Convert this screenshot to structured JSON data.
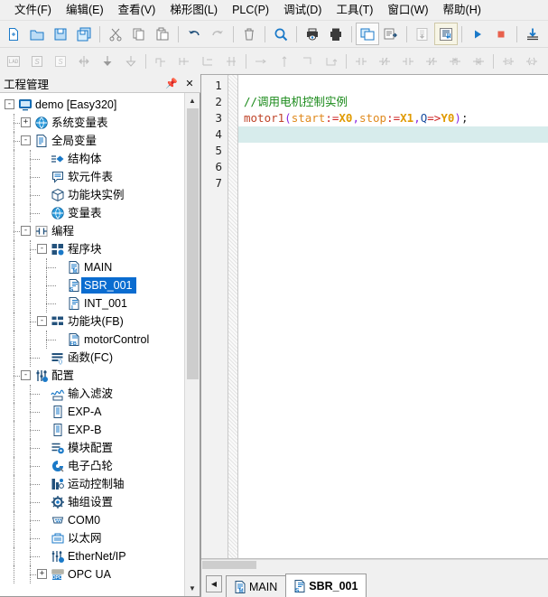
{
  "menubar": {
    "items": [
      {
        "label": "文件(F)",
        "name": "menu-file"
      },
      {
        "label": "编辑(E)",
        "name": "menu-edit"
      },
      {
        "label": "查看(V)",
        "name": "menu-view"
      },
      {
        "label": "梯形图(L)",
        "name": "menu-ladder"
      },
      {
        "label": "PLC(P)",
        "name": "menu-plc"
      },
      {
        "label": "调试(D)",
        "name": "menu-debug"
      },
      {
        "label": "工具(T)",
        "name": "menu-tools"
      },
      {
        "label": "窗口(W)",
        "name": "menu-window"
      },
      {
        "label": "帮助(H)",
        "name": "menu-help"
      }
    ]
  },
  "toolbar_row1": {
    "icons": [
      "new-file-icon",
      "open-folder-icon",
      "save-icon",
      "save-all-icon",
      "sep",
      "cut-icon",
      "copy-icon",
      "paste-icon",
      "sep",
      "undo-icon",
      "redo-icon",
      "sep",
      "delete-icon",
      "sep",
      "search-icon",
      "sep",
      "print-preview-icon",
      "print-icon",
      "sep",
      "compile-icon",
      "compile-all-icon",
      "sep",
      "upload-plc-icon",
      "download-plc-icon",
      "sep",
      "run-icon",
      "stop-icon",
      "sep",
      "download-icon"
    ]
  },
  "toolbar_row2": {
    "icons": [
      "lad-mode-icon",
      "stl-mode-icon",
      "sfc-mode-icon",
      "insert-row-icon",
      "insert-below-icon",
      "append-row-icon",
      "sep",
      "branch-up-icon",
      "branch-down-icon",
      "branch-left-icon",
      "branch-right-icon",
      "sep",
      "hline-icon",
      "vline-icon",
      "corner-icon",
      "corner2-icon",
      "sep",
      "contact-no-icon",
      "contact-nc-icon",
      "contact-no2-icon",
      "contact-nc2-icon",
      "contact-rising-icon",
      "contact-falling-icon",
      "sep",
      "set-coil-icon",
      "reset-coil-icon"
    ]
  },
  "left_panel": {
    "title": "工程管理",
    "pin_icon": "pin-icon",
    "close_icon": "close-icon",
    "scroll_up_icon": "chevron-up-icon",
    "scroll_down_icon": "chevron-down-icon",
    "tree": [
      {
        "label": "demo [Easy320]",
        "icon": "monitor-icon",
        "indent": 0,
        "expander": "-",
        "name": "tree-item-demo"
      },
      {
        "label": "系统变量表",
        "icon": "globe-icon",
        "indent": 1,
        "expander": "+",
        "name": "tree-item-system-var-table"
      },
      {
        "label": "全局变量",
        "icon": "document-list-icon",
        "indent": 1,
        "expander": "-",
        "name": "tree-item-global-variables"
      },
      {
        "label": "结构体",
        "icon": "struct-icon",
        "indent": 2,
        "expander": "",
        "name": "tree-item-struct"
      },
      {
        "label": "软元件表",
        "icon": "device-table-icon",
        "indent": 2,
        "expander": "",
        "name": "tree-item-device-table"
      },
      {
        "label": "功能块实例",
        "icon": "cube-icon",
        "indent": 2,
        "expander": "",
        "name": "tree-item-fb-instance"
      },
      {
        "label": "变量表",
        "icon": "globe-icon",
        "indent": 2,
        "expander": "",
        "name": "tree-item-variable-table"
      },
      {
        "label": "编程",
        "icon": "contact-icon",
        "indent": 1,
        "expander": "-",
        "name": "tree-item-programming"
      },
      {
        "label": "程序块",
        "icon": "blocks-icon",
        "indent": 2,
        "expander": "-",
        "name": "tree-item-program-blocks"
      },
      {
        "label": "MAIN",
        "icon": "main-pou-icon",
        "indent": 3,
        "expander": "",
        "name": "tree-item-main"
      },
      {
        "label": "SBR_001",
        "icon": "sbr-pou-icon",
        "indent": 3,
        "expander": "",
        "selected": true,
        "name": "tree-item-sbr-001"
      },
      {
        "label": "INT_001",
        "icon": "int-pou-icon",
        "indent": 3,
        "expander": "",
        "name": "tree-item-int-001"
      },
      {
        "label": "功能块(FB)",
        "icon": "fb-group-icon",
        "indent": 2,
        "expander": "-",
        "name": "tree-item-function-blocks"
      },
      {
        "label": "motorControl",
        "icon": "fb-icon",
        "indent": 3,
        "expander": "",
        "name": "tree-item-motorcontrol"
      },
      {
        "label": "函数(FC)",
        "icon": "fc-icon",
        "indent": 2,
        "expander": "",
        "name": "tree-item-functions"
      },
      {
        "label": "配置",
        "icon": "config-icon",
        "indent": 1,
        "expander": "-",
        "name": "tree-item-configuration"
      },
      {
        "label": "输入滤波",
        "icon": "wave-icon",
        "indent": 2,
        "expander": "",
        "name": "tree-item-input-filter"
      },
      {
        "label": "EXP-A",
        "icon": "module-icon",
        "indent": 2,
        "expander": "",
        "name": "tree-item-exp-a"
      },
      {
        "label": "EXP-B",
        "icon": "module-icon",
        "indent": 2,
        "expander": "",
        "name": "tree-item-exp-b"
      },
      {
        "label": "模块配置",
        "icon": "module-config-icon",
        "indent": 2,
        "expander": "",
        "name": "tree-item-module-config"
      },
      {
        "label": "电子凸轮",
        "icon": "cam-icon",
        "indent": 2,
        "expander": "",
        "name": "tree-item-electronic-cam"
      },
      {
        "label": "运动控制轴",
        "icon": "motion-axis-icon",
        "indent": 2,
        "expander": "",
        "name": "tree-item-motion-axis"
      },
      {
        "label": "轴组设置",
        "icon": "gear-icon",
        "indent": 2,
        "expander": "",
        "name": "tree-item-axis-group"
      },
      {
        "label": "COM0",
        "icon": "serial-port-icon",
        "indent": 2,
        "expander": "",
        "name": "tree-item-com0"
      },
      {
        "label": "以太网",
        "icon": "ethernet-icon",
        "indent": 2,
        "expander": "",
        "name": "tree-item-ethernet"
      },
      {
        "label": "EtherNet/IP",
        "icon": "ethernetip-icon",
        "indent": 2,
        "expander": "",
        "name": "tree-item-ethernet-ip"
      },
      {
        "label": "OPC UA",
        "icon": "opcua-icon",
        "indent": 2,
        "expander": "+",
        "name": "tree-item-opc-ua"
      }
    ]
  },
  "editor": {
    "line_numbers": [
      "1",
      "2",
      "3",
      "4",
      "5",
      "6",
      "7"
    ],
    "current_line": 4,
    "lines": [
      {
        "n": 1,
        "tokens": []
      },
      {
        "n": 2,
        "tokens": [
          {
            "t": "//调用电机控制实例",
            "c": "cmt"
          }
        ]
      },
      {
        "n": 3,
        "tokens": [
          {
            "t": "motor1",
            "c": "fn"
          },
          {
            "t": "(",
            "c": "par"
          },
          {
            "t": "start",
            "c": "arg"
          },
          {
            "t": ":=",
            "c": "op"
          },
          {
            "t": "X0",
            "c": "addr"
          },
          {
            "t": ",",
            "c": "par"
          },
          {
            "t": "stop",
            "c": "arg"
          },
          {
            "t": ":=",
            "c": "op"
          },
          {
            "t": "X1",
            "c": "addr"
          },
          {
            "t": ",",
            "c": "par"
          },
          {
            "t": "Q",
            "c": "qv"
          },
          {
            "t": "=>",
            "c": "op"
          },
          {
            "t": "Y0",
            "c": "addr"
          },
          {
            "t": ")",
            "c": "par"
          },
          {
            "t": ";",
            "c": "semi"
          }
        ]
      },
      {
        "n": 4,
        "tokens": []
      },
      {
        "n": 5,
        "tokens": []
      },
      {
        "n": 6,
        "tokens": []
      },
      {
        "n": 7,
        "tokens": []
      }
    ]
  },
  "tabs": {
    "nav_icon": "tab-prev-icon",
    "items": [
      {
        "label": "MAIN",
        "icon": "main-pou-icon",
        "active": false,
        "name": "tab-main"
      },
      {
        "label": "SBR_001",
        "icon": "sbr-pou-icon",
        "active": true,
        "name": "tab-sbr-001"
      }
    ]
  },
  "colors": {
    "accent_blue": "#0a6cd0",
    "comment_green": "#1a8a1a",
    "function_red": "#c0452a",
    "paren_purple": "#8a2be2",
    "arg_orange": "#e08a1e",
    "address_gold": "#e09a00",
    "current_line": "#d7ecec",
    "chrome_gray": "#f0f0f0"
  }
}
